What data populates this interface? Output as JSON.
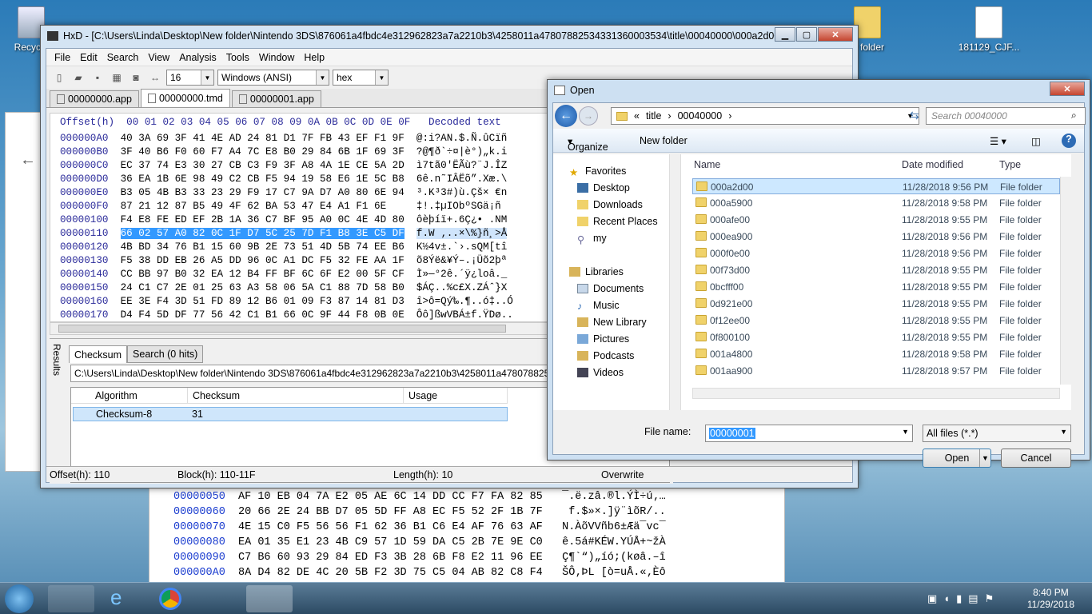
{
  "desktop": {
    "icons": [
      {
        "label": "Recycle"
      },
      {
        "label": "w folder"
      },
      {
        "label": "181129_CJF..."
      }
    ]
  },
  "bg_hex": {
    "rows": [
      {
        "offset": "00000050",
        "hex": "AF 10 EB 04 7A E2 05 AE 6C 14 DD CC F7 FA 82 85",
        "text": "¯.ë.zâ.®l.ÝÌ÷ú‚…"
      },
      {
        "offset": "00000060",
        "hex": "20 66 2E 24 BB D7 05 5D FF A8 EC F5 52 2F 1B 7F",
        "text": " f.$»×.]ÿ¨ìõR/.."
      },
      {
        "offset": "00000070",
        "hex": "4E 15 C0 F5 56 56 F1 62 36 B1 C6 E4 AF 76 63 AF",
        "text": "N.ÀõVVñb6±Æä¯vc¯"
      },
      {
        "offset": "00000080",
        "hex": "EA 01 35 E1 23 4B C9 57 1D 59 DA C5 2B 7E 9E C0",
        "text": "ê.5á#KÉW.YÚÅ+~žÀ"
      },
      {
        "offset": "00000090",
        "hex": "C7 B6 60 93 29 84 ED F3 3B 28 6B F8 E2 11 96 EE",
        "text": "Ç¶`“)„íó;(køâ.–î"
      },
      {
        "offset": "000000A0",
        "hex": "8A D4 82 DE 4C 20 5B F2 3D 75 C5 04 AB 82 C8 F4",
        "text": "ŠÔ‚ÞL [ò=uÅ.«‚Èô"
      }
    ]
  },
  "hxd": {
    "title": "HxD - [C:\\Users\\Linda\\Desktop\\New folder\\Nintendo 3DS\\876061a4fbdc4e312962823a7a2210b3\\4258011a47807882534331360003534\\title\\00040000\\000a2d00\\c...",
    "menu": [
      "File",
      "Edit",
      "Search",
      "View",
      "Analysis",
      "Tools",
      "Window",
      "Help"
    ],
    "toolbar": {
      "bytes_per_row": "16",
      "charset": "Windows (ANSI)",
      "format": "hex"
    },
    "tabs": [
      "00000000.app",
      "00000000.tmd",
      "00000001.app"
    ],
    "header": {
      "offset_label": "Offset(h)",
      "cols": "00 01 02 03 04 05 06 07 08 09 0A 0B 0C 0D 0E 0F",
      "decoded_label": "Decoded text"
    },
    "rows": [
      {
        "offset": "000000A0",
        "hex": "40 3A 69 3F 41 4E AD 24 81 D1 7F FB 43 EF F1 9F",
        "text": "@:i?AN.$.Ñ.ûCïñ"
      },
      {
        "offset": "000000B0",
        "hex": "3F 40 B6 F0 60 F7 A4 7C E8 B0 29 84 6B 1F 69 3F",
        "text": "?@¶ð`÷¤|è°)„k.i"
      },
      {
        "offset": "000000C0",
        "hex": "EC 37 74 E3 30 27 CB C3 F9 3F A8 4A 1E CE 5A 2D",
        "text": "ì7tã0'ËÃù?¨J.ÎZ"
      },
      {
        "offset": "000000D0",
        "hex": "36 EA 1B 6E 98 49 C2 CB F5 94 19 58 E6 1E 5C B8",
        "text": "6ê.n˜IÂËõ”.Xæ.\\"
      },
      {
        "offset": "000000E0",
        "hex": "B3 05 4B B3 33 23 29 F9 17 C7 9A D7 A0 80 6E 94",
        "text": "³.K³3#)ù.Çš× €n"
      },
      {
        "offset": "000000F0",
        "hex": "87 21 12 87 B5 49 4F 62 BA 53 47 E4 A1 F1 6E",
        "text": "‡!.‡µIObºSGä¡ñ"
      },
      {
        "offset": "00000100",
        "hex": "F4 E8 FE ED EF 2B 1A 36 C7 BF 95 A0 0C 4E 4D 80",
        "text": "ôèþíï+.6Ç¿• .NM"
      },
      {
        "offset": "00000110",
        "hex": "66 02 57 A0 82 0C 1F D7 5C 25 7D F1 B8 3E C5 DF",
        "text": "f.W ‚..×\\%}ñ¸>Å"
      },
      {
        "offset": "00000120",
        "hex": "4B BD 34 76 B1 15 60 9B 2E 73 51 4D 5B 74 EE B6",
        "text": "K½4v±.`›.sQM[tî"
      },
      {
        "offset": "00000130",
        "hex": "F5 38 DD EB 26 A5 DD 96 0C A1 DC F5 32 FE AA 1F",
        "text": "õ8Ýë&¥Ý–.¡Üõ2þª"
      },
      {
        "offset": "00000140",
        "hex": "CC BB 97 B0 32 EA 12 B4 FF BF 6C 6F E2 00 5F CF",
        "text": "Ì»—°2ê.´ÿ¿loâ._"
      },
      {
        "offset": "00000150",
        "hex": "24 C1 C7 2E 01 25 63 A3 58 06 5A C1 88 7D 58 B0",
        "text": "$ÁÇ..%c£X.ZÁˆ}X"
      },
      {
        "offset": "00000160",
        "hex": "EE 3E F4 3D 51 FD 89 12 B6 01 09 F3 87 14 81 D3",
        "text": "î>ô=Qý‰.¶..ó‡..Ó"
      },
      {
        "offset": "00000170",
        "hex": "D4 F4 5D DF 77 56 42 C1 B1 66 0C 9F 44 F8 0B 0E",
        "text": "Ôô]ßwVBÁ±f.ŸDø.."
      }
    ],
    "selected_row": "00000110",
    "results": {
      "side_label": "Results",
      "tabs": [
        "Checksum",
        "Search (0 hits)"
      ],
      "path": "C:\\Users\\Linda\\Desktop\\New folder\\Nintendo 3DS\\876061a4fbdc4e312962823a7a2210b3\\4258011a4780788253433",
      "columns": [
        "Algorithm",
        "Checksum",
        "Usage"
      ],
      "row": {
        "algorithm": "Checksum-8",
        "checksum": "31",
        "usage": ""
      }
    },
    "status": {
      "offset": "Offset(h): 110",
      "block": "Block(h): 110-11F",
      "length": "Length(h): 10",
      "mode": "Overwrite"
    }
  },
  "open_dialog": {
    "title": "Open",
    "breadcrumb": [
      "«",
      "title",
      "00040000"
    ],
    "search_placeholder": "Search 00040000",
    "commands": {
      "organize": "Organize",
      "new_folder": "New folder"
    },
    "nav": {
      "favorites_label": "Favorites",
      "favorites": [
        "Desktop",
        "Downloads",
        "Recent Places",
        "my"
      ],
      "libraries_label": "Libraries",
      "libraries": [
        "Documents",
        "Music",
        "New Library",
        "Pictures",
        "Podcasts",
        "Videos"
      ]
    },
    "columns": [
      "Name",
      "Date modified",
      "Type"
    ],
    "files": [
      {
        "name": "000a2d00",
        "date": "11/28/2018 9:56 PM",
        "type": "File folder"
      },
      {
        "name": "000a5900",
        "date": "11/28/2018 9:58 PM",
        "type": "File folder"
      },
      {
        "name": "000afe00",
        "date": "11/28/2018 9:55 PM",
        "type": "File folder"
      },
      {
        "name": "000ea900",
        "date": "11/28/2018 9:56 PM",
        "type": "File folder"
      },
      {
        "name": "000f0e00",
        "date": "11/28/2018 9:56 PM",
        "type": "File folder"
      },
      {
        "name": "00f73d00",
        "date": "11/28/2018 9:55 PM",
        "type": "File folder"
      },
      {
        "name": "0bcfff00",
        "date": "11/28/2018 9:55 PM",
        "type": "File folder"
      },
      {
        "name": "0d921e00",
        "date": "11/28/2018 9:55 PM",
        "type": "File folder"
      },
      {
        "name": "0f12ee00",
        "date": "11/28/2018 9:55 PM",
        "type": "File folder"
      },
      {
        "name": "0f800100",
        "date": "11/28/2018 9:55 PM",
        "type": "File folder"
      },
      {
        "name": "001a4800",
        "date": "11/28/2018 9:58 PM",
        "type": "File folder"
      },
      {
        "name": "001aa900",
        "date": "11/28/2018 9:57 PM",
        "type": "File folder"
      }
    ],
    "file_name_label": "File name:",
    "file_name_value": "00000001",
    "file_type": "All files (*.*)",
    "open_label": "Open",
    "cancel_label": "Cancel"
  },
  "taskbar": {
    "time": "8:40 PM",
    "date": "11/29/2018"
  },
  "colors": {
    "selection": "#3399ff",
    "offset_blue": "#2a2a9a",
    "taskbar": "#2c4a63"
  }
}
